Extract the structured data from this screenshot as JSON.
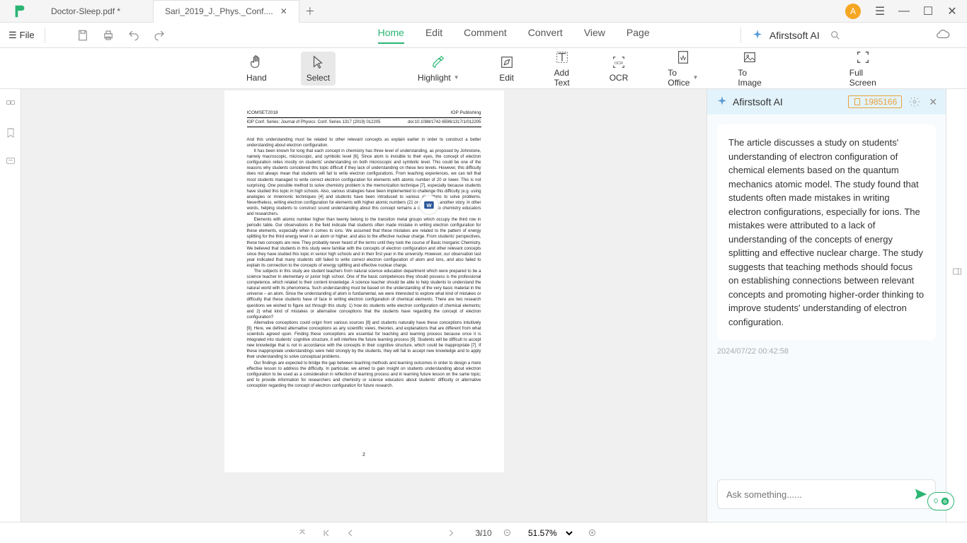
{
  "tabs": [
    {
      "label": "Doctor-Sleep.pdf *"
    },
    {
      "label": "Sari_2019_J._Phys._Conf...."
    }
  ],
  "avatar_initial": "A",
  "file_menu": "File",
  "main_tabs": [
    "Home",
    "Edit",
    "Comment",
    "Convert",
    "View",
    "Page"
  ],
  "ai_brand": "Afirstsoft AI",
  "tools": {
    "hand": "Hand",
    "select": "Select",
    "highlight": "Highlight",
    "edit": "Edit",
    "add_text": "Add Text",
    "ocr": "OCR",
    "to_office": "To Office",
    "to_image": "To Image",
    "full": "Full Screen"
  },
  "document": {
    "conf_left": "ICOMSET2018",
    "conf_right": "IOP Publishing",
    "series_left": "IOP Conf. Series: Journal of Physics: Conf. Series 1317 (2019) 012205",
    "series_right": "doi:10.1088/1742-6596/1317/1/012205",
    "body": {
      "p1": "And this understanding must be related to other relevant concepts as explain earlier in order to construct a better understanding about electron configuration.",
      "p2": "It has been known for long that each concept in chemistry has three level of understanding, as proposed by Johnstone, namely macroscopic, microscopic, and symbolic level [6]. Since atom is invisible to their eyes, the concept of electron configuration relies mostly on students' understanding on both microscopic and symbolic level. This could be one of the reasons why students considered this topic difficult if they lack of understanding on these two levels. However, this difficulty does not always mean that students will fail to write electron configurations. From teaching experiences, we can tell that most students managed to write correct electron configuration for elements with atomic number of 20 or lower. This is not surprising. One possible method to solve chemistry problem is the memorization technique [7], especially because students have studied this topic in high schools. Also, various strategies have been implemented to challenge this difficulty (e.g. using analogies or mnemonic techniques [4] and students have been introduced to various algorithms to solve problems. Nevertheless, writing electron configuration for elements with higher atomic numbers (21 or greater) is another story. In other words, helping students to construct sound understanding about this concept remains a challenge to chemistry educators and researchers.",
      "p3": "Elements with atomic number higher than twenty belong to the transition metal groups which occupy the third row in periodic table. Our observations in the field indicate that students often made mistake in writing electron configuration for these elements, especially when it comes to ions. We assumed that these mistakes are related to the pattern of energy splitting for the third energy level in an atom or higher, and also to the effective nuclear charge. From students' perspectives, these two concepts are new. They probably never heard of the terms until they took the course of Basic Inorganic Chemistry. We believed that students in this study were familiar with the concepts of electron configuration and other relevant concepts since they have studied this topic in senior high schools and in their first year in the university. However, our observation last year indicated that many students still failed to write correct electron configuration of atom and ions, and also failed to explain its connection to the concepts of energy splitting and effective nuclear charge.",
      "p4": "The subjects in this study are student teachers from natural science education department which were prepared to be a science teacher in elementary or junior high school. One of the basic competences they should possess is the professional competence, which related to their content knowledge. A science teacher should be able to help students to understand the natural world with its phenomena. Such understanding must be based on the understanding of the very basic material in the universe – an atom. Since the understanding of atom is fundamental, we were interested to explore what kind of mistakes or difficulty that these students have of face in writing electron configuration of chemical elements. There are two research questions we wished to figure out through this study: 1) how do students write electron configuration of chemical elements; and 2) what kind of mistakes or alternative conceptions that the students have regarding the concept of electron configuration?",
      "p5": "Alternative conceptions could origin from various sources [8] and students naturally have these conceptions intuitively [9]. Here, we defined alternative conceptions as any scientific views, theories, and explanations that are different from what scientists agreed upon. Finding these conceptions are essential for teaching and learning process because once it is integrated into students' cognitive structure, it will interfere the future learning process [9]. Students will be difficult to accept new knowledge that is not in accordance with the concepts in their cognitive structure, which could be inappropriate [7]. If these inappropriate understandings were held strongly by the students, they will fail to accept new knowledge and to apply their understanding to solve conceptual problems.",
      "p6": "Our findings are expected to bridge the gap between teaching methods and learning outcomes in order to design a more effective lesson to address the difficulty. In particular, we aimed to gain insight on students understanding about electron configuration to be used as a consideration in reflection of learning process and in learning future lesson on the same topic; and to provide information for researchers and chemistry or science educators about students' difficulty or alternative conception regarding the concept of electron configuration for future research."
    },
    "page_number": "2"
  },
  "ai": {
    "count": "1985166",
    "summary": "The article discusses a study on students' understanding of electron configuration of chemical elements based on the quantum mechanics atomic model. The study found that students often made mistakes in writing electron configurations, especially for ions. The mistakes were attributed to a lack of understanding of the concepts of energy splitting and effective nuclear charge. The study suggests that teaching methods should focus on establishing connections between relevant concepts and promoting higher-order thinking to improve students' understanding of electron configuration.",
    "timestamp": "2024/07/22 00:42:58",
    "placeholder": "Ask something......"
  },
  "status": {
    "page_indicator": "3/10",
    "zoom": "51.57%"
  }
}
